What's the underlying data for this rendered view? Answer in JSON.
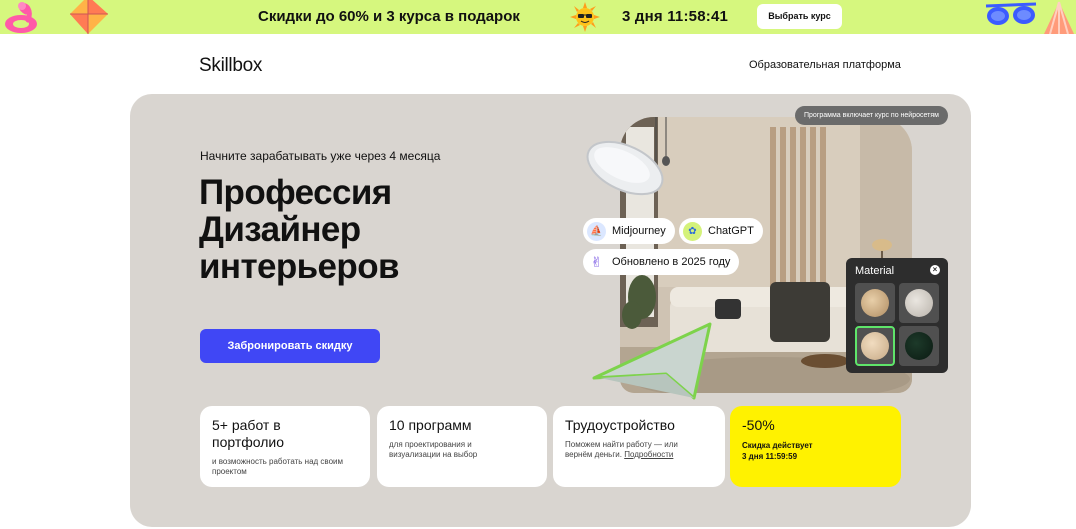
{
  "promo": {
    "text": "Скидки до 60% и 3 курса в подарок",
    "timer": "3 дня  11:58:41",
    "button": "Выбрать курс",
    "accent_color": "#d6f77e"
  },
  "header": {
    "logo": "Skillbox",
    "tagline": "Образовательная платформа"
  },
  "hero": {
    "subtitle": "Начните зарабатывать уже через 4 месяца",
    "title_lines": [
      "Профессия",
      "Дизайнер",
      "интерьеров"
    ],
    "cta": "Забронировать скидку",
    "cta_color": "#4047f5",
    "badge": "Программа включает курс по нейросетям",
    "chips": [
      "Midjourney",
      "ChatGPT",
      "Обновлено в 2025 году"
    ],
    "material": {
      "title": "Material",
      "selected_index": 2
    }
  },
  "cards": [
    {
      "title": "5+ работ в портфолио",
      "desc": "и возможность работать над своим проектом"
    },
    {
      "title": "10 программ",
      "desc": "для проектирования и визуализации на выбор"
    },
    {
      "title": "Трудоустройство",
      "desc_prefix": "Поможем найти работу — или вернём деньги.",
      "desc_link": "Подробности"
    },
    {
      "title": "-50%",
      "desc_line1": "Скидка  действует",
      "desc_line2": "3 дня 11:59:59",
      "color": "#fff200"
    }
  ]
}
